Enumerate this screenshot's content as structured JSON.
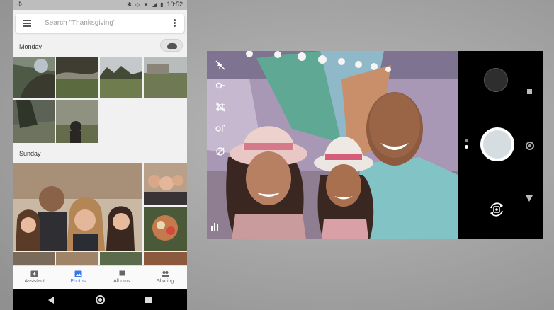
{
  "status_bar": {
    "time": "10:52"
  },
  "search": {
    "placeholder": "Search \"Thanksgiving\""
  },
  "sections": [
    {
      "label": "Monday"
    },
    {
      "label": "Sunday"
    }
  ],
  "bottom_nav": [
    {
      "label": "Assistant",
      "icon": "assistant-icon",
      "active": false
    },
    {
      "label": "Photos",
      "icon": "photos-icon",
      "active": true
    },
    {
      "label": "Albums",
      "icon": "albums-icon",
      "active": false
    },
    {
      "label": "Sharing",
      "icon": "sharing-icon",
      "active": false
    }
  ],
  "android_nav": [
    "back-icon",
    "home-icon",
    "recents-icon"
  ],
  "camera": {
    "viewfinder_icons": [
      "flash-off-icon",
      "timer-icon",
      "grid-icon",
      "hdr-icon",
      "exposure-icon",
      "histogram-icon"
    ],
    "control_icons": [
      "thumbnail-preview",
      "photo-mode-icon",
      "shutter-button",
      "video-mode-icon",
      "switch-camera-icon",
      "more-icon"
    ]
  },
  "colors": {
    "accent": "#3b78e7",
    "control_bg": "#000000",
    "shutter": "#d6dde1"
  }
}
